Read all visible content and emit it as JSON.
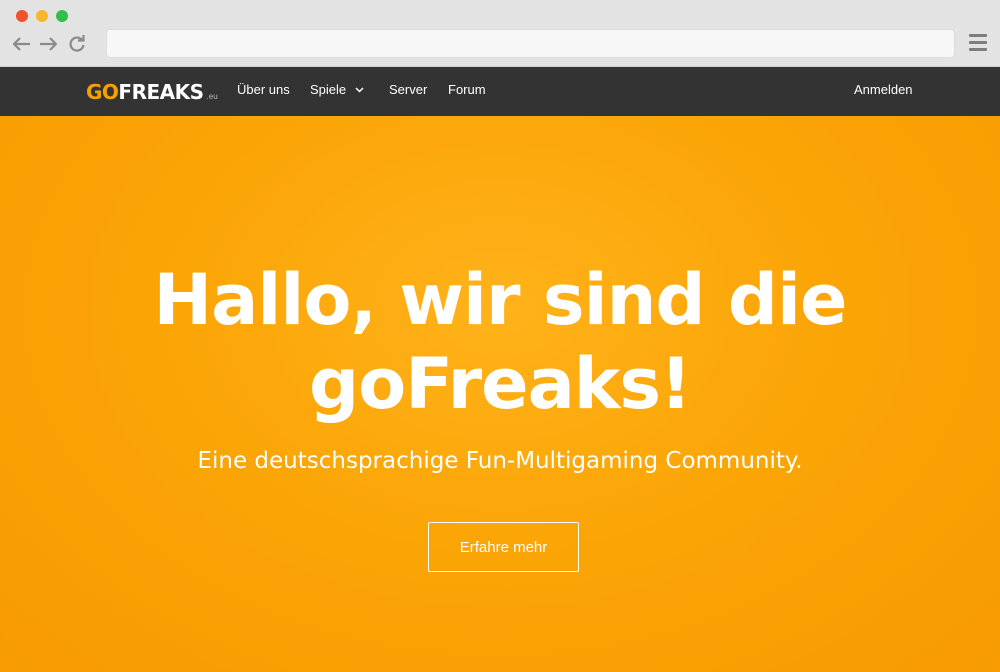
{
  "browser": {
    "address_value": "",
    "icons": [
      "back-arrow-icon",
      "forward-arrow-icon",
      "reload-icon",
      "hamburger-menu-icon"
    ]
  },
  "site": {
    "logo": {
      "go": "GO",
      "reaks": "FREAKS",
      "tld": ".eu"
    },
    "nav": {
      "items": [
        {
          "label": "Über uns"
        },
        {
          "label": "Spiele",
          "has_dropdown": true
        },
        {
          "label": "Server"
        },
        {
          "label": "Forum"
        }
      ],
      "login_label": "Anmelden"
    },
    "hero": {
      "title_line1": "Hallo, wir sind die",
      "title_line2": "goFreaks!",
      "subtitle": "Eine deutschsprachige Fun-Multigaming Community.",
      "button_label": "Erfahre mehr"
    }
  },
  "colors": {
    "accent": "#f6a000",
    "nav_bg": "#333333",
    "hero_bg": "#fba507"
  }
}
